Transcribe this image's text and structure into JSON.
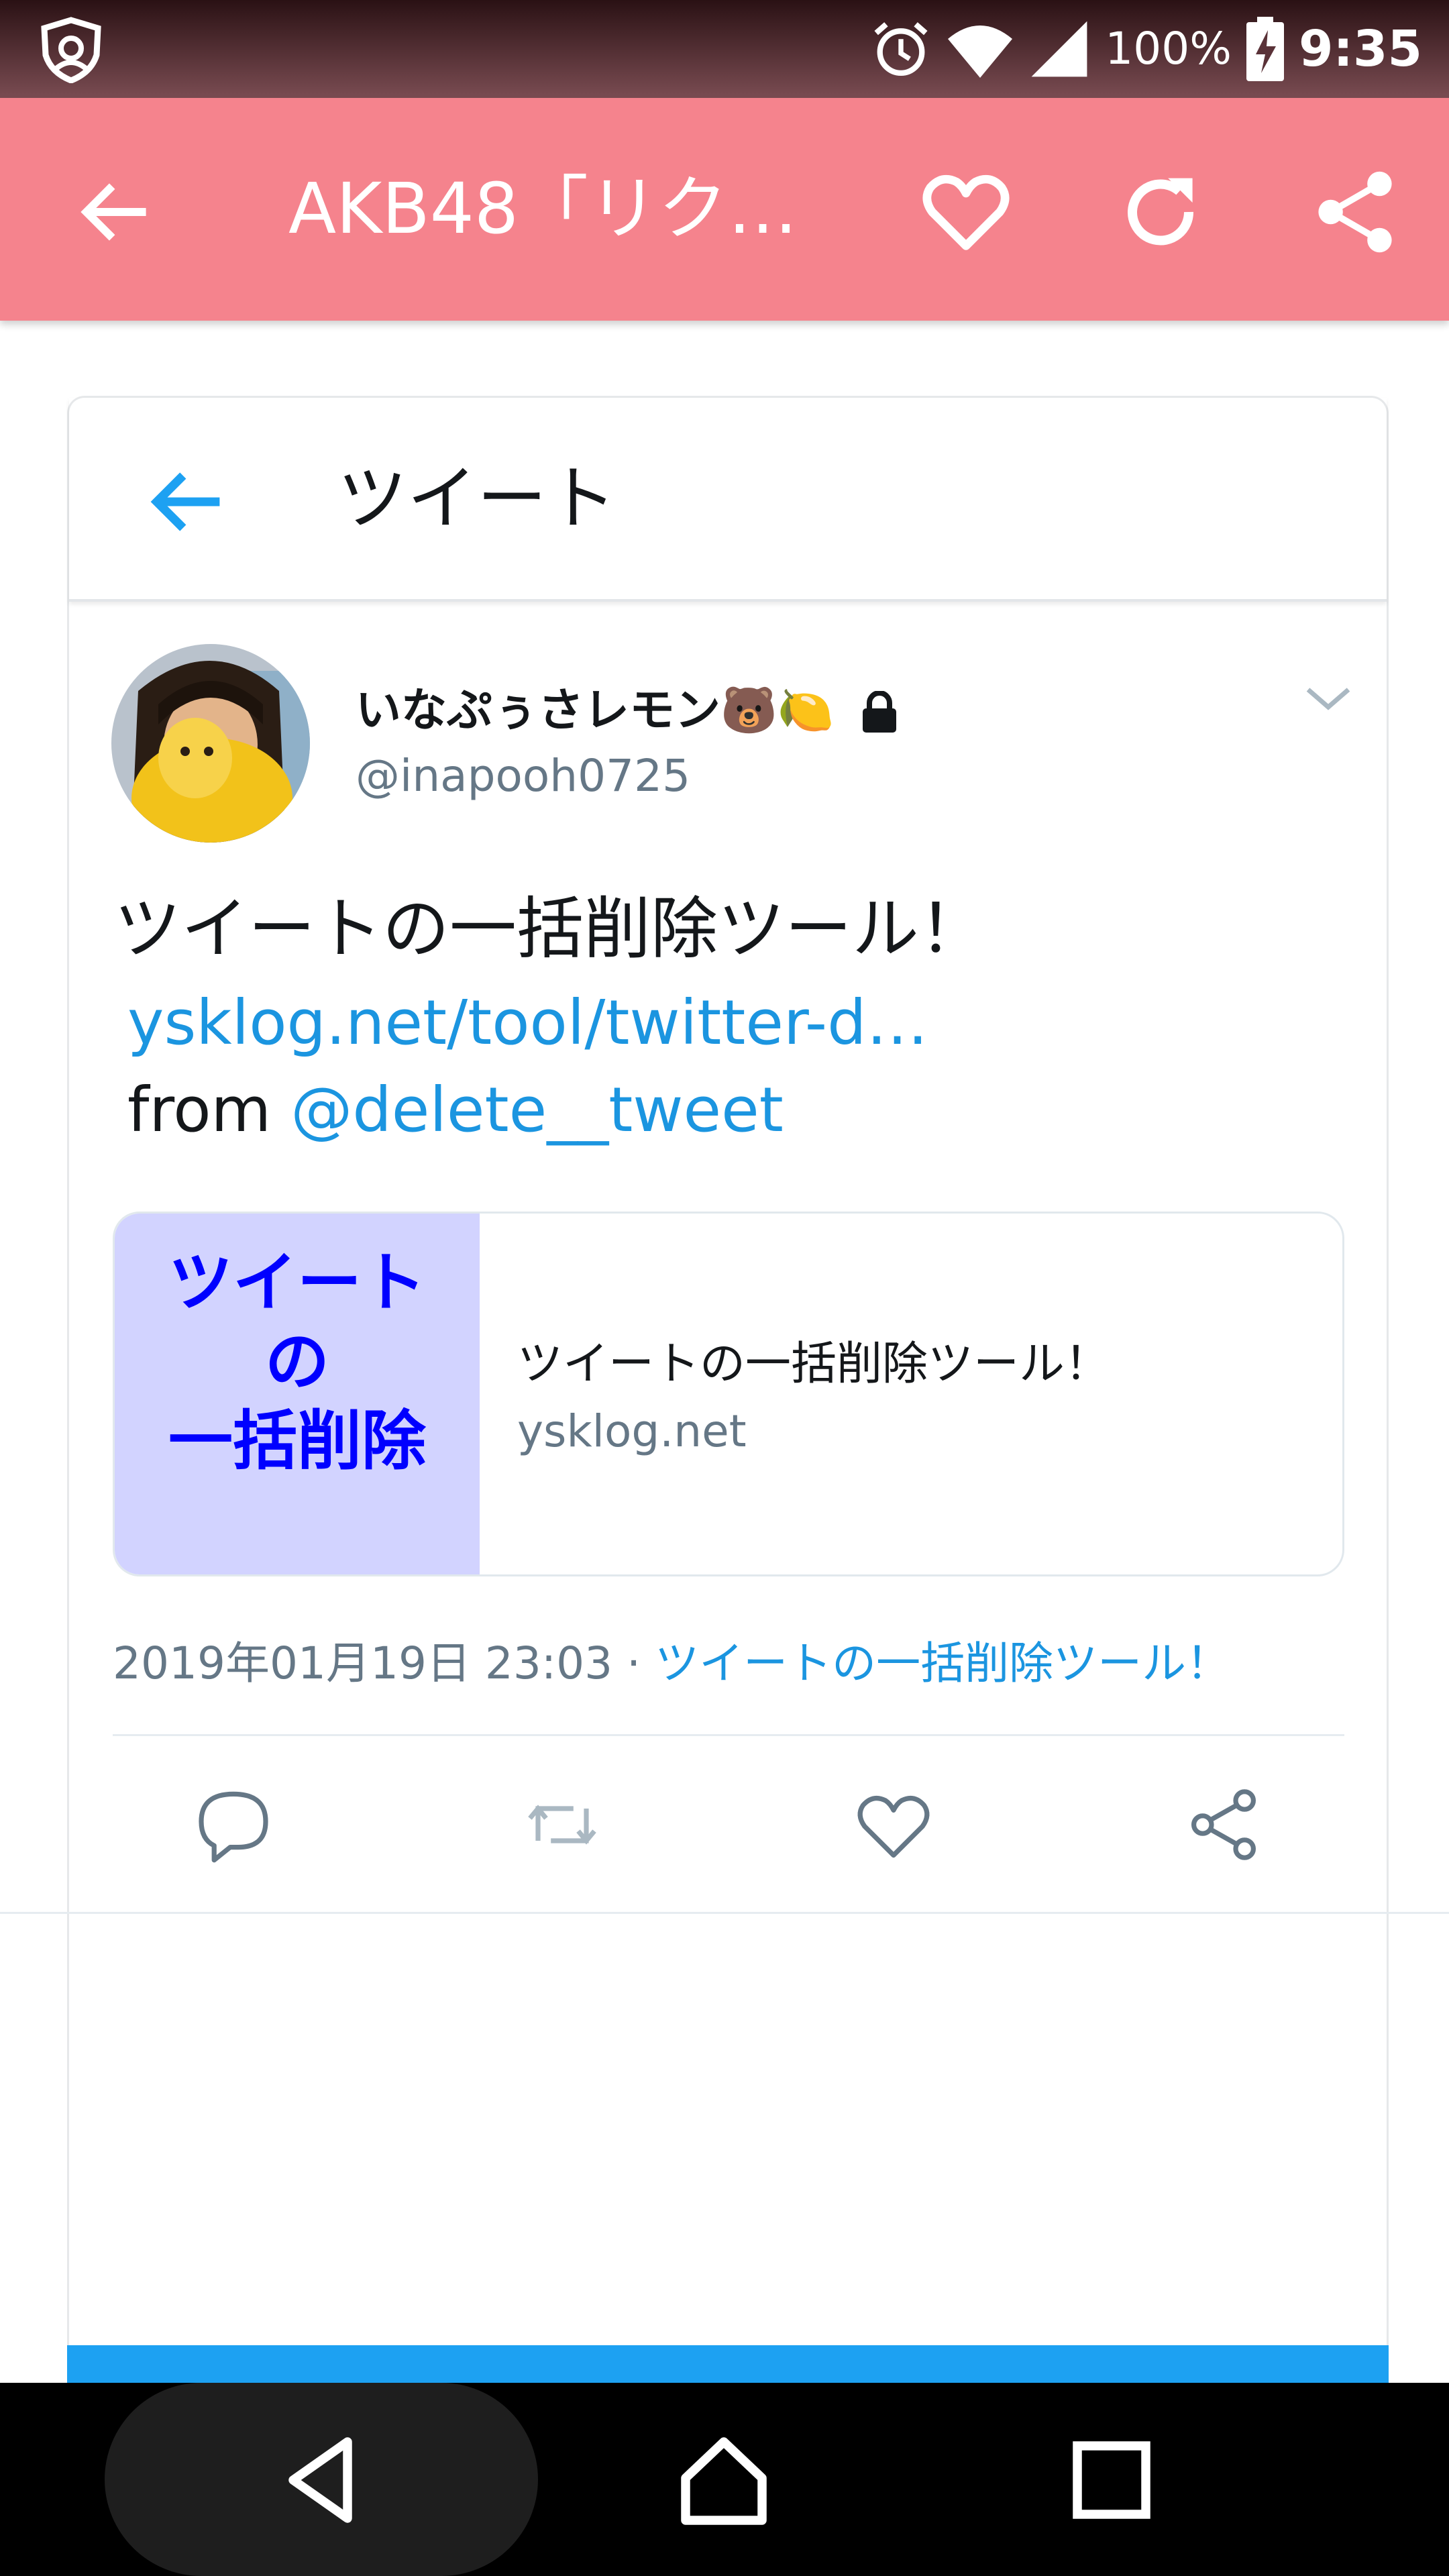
{
  "status_bar": {
    "battery": "100%",
    "time": "9:35"
  },
  "app_bar": {
    "title": "AKB48「リク…",
    "colors": {
      "background": "#f5838d"
    }
  },
  "card_header": {
    "title": "ツイート"
  },
  "tweet": {
    "user_name": "いなぷぅさレモン🐻🍋",
    "handle": "@inapooh0725",
    "text": "ツイートの一括削除ツール！",
    "link": "ysklog.net/tool/twitter-d…",
    "from_label": "from",
    "from_mention": "@delete__tweet",
    "link_card": {
      "thumb_lines": [
        "ツイート",
        "の",
        "一括削除"
      ],
      "title": "ツイートの一括削除ツール！",
      "domain": "ysklog.net"
    },
    "timestamp": "2019年01月19日 23:03",
    "separator": " · ",
    "source": "ツイートの一括削除ツール！"
  }
}
